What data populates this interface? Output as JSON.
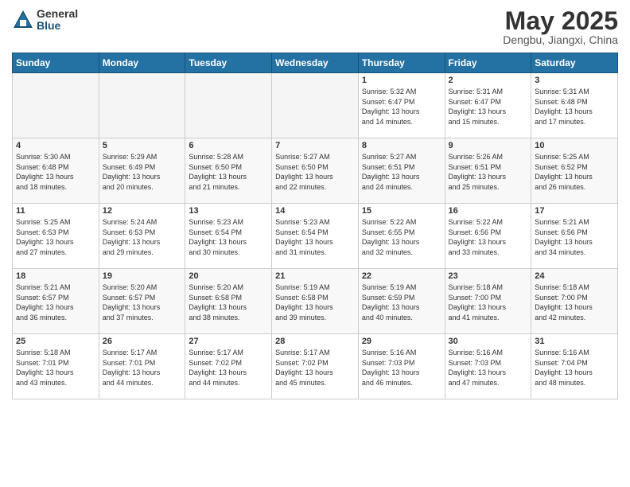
{
  "header": {
    "logo_general": "General",
    "logo_blue": "Blue",
    "month_year": "May 2025",
    "location": "Dengbu, Jiangxi, China"
  },
  "weekdays": [
    "Sunday",
    "Monday",
    "Tuesday",
    "Wednesday",
    "Thursday",
    "Friday",
    "Saturday"
  ],
  "weeks": [
    [
      {
        "day": "",
        "info": ""
      },
      {
        "day": "",
        "info": ""
      },
      {
        "day": "",
        "info": ""
      },
      {
        "day": "",
        "info": ""
      },
      {
        "day": "1",
        "info": "Sunrise: 5:32 AM\nSunset: 6:47 PM\nDaylight: 13 hours\nand 14 minutes."
      },
      {
        "day": "2",
        "info": "Sunrise: 5:31 AM\nSunset: 6:47 PM\nDaylight: 13 hours\nand 15 minutes."
      },
      {
        "day": "3",
        "info": "Sunrise: 5:31 AM\nSunset: 6:48 PM\nDaylight: 13 hours\nand 17 minutes."
      }
    ],
    [
      {
        "day": "4",
        "info": "Sunrise: 5:30 AM\nSunset: 6:48 PM\nDaylight: 13 hours\nand 18 minutes."
      },
      {
        "day": "5",
        "info": "Sunrise: 5:29 AM\nSunset: 6:49 PM\nDaylight: 13 hours\nand 20 minutes."
      },
      {
        "day": "6",
        "info": "Sunrise: 5:28 AM\nSunset: 6:50 PM\nDaylight: 13 hours\nand 21 minutes."
      },
      {
        "day": "7",
        "info": "Sunrise: 5:27 AM\nSunset: 6:50 PM\nDaylight: 13 hours\nand 22 minutes."
      },
      {
        "day": "8",
        "info": "Sunrise: 5:27 AM\nSunset: 6:51 PM\nDaylight: 13 hours\nand 24 minutes."
      },
      {
        "day": "9",
        "info": "Sunrise: 5:26 AM\nSunset: 6:51 PM\nDaylight: 13 hours\nand 25 minutes."
      },
      {
        "day": "10",
        "info": "Sunrise: 5:25 AM\nSunset: 6:52 PM\nDaylight: 13 hours\nand 26 minutes."
      }
    ],
    [
      {
        "day": "11",
        "info": "Sunrise: 5:25 AM\nSunset: 6:53 PM\nDaylight: 13 hours\nand 27 minutes."
      },
      {
        "day": "12",
        "info": "Sunrise: 5:24 AM\nSunset: 6:53 PM\nDaylight: 13 hours\nand 29 minutes."
      },
      {
        "day": "13",
        "info": "Sunrise: 5:23 AM\nSunset: 6:54 PM\nDaylight: 13 hours\nand 30 minutes."
      },
      {
        "day": "14",
        "info": "Sunrise: 5:23 AM\nSunset: 6:54 PM\nDaylight: 13 hours\nand 31 minutes."
      },
      {
        "day": "15",
        "info": "Sunrise: 5:22 AM\nSunset: 6:55 PM\nDaylight: 13 hours\nand 32 minutes."
      },
      {
        "day": "16",
        "info": "Sunrise: 5:22 AM\nSunset: 6:56 PM\nDaylight: 13 hours\nand 33 minutes."
      },
      {
        "day": "17",
        "info": "Sunrise: 5:21 AM\nSunset: 6:56 PM\nDaylight: 13 hours\nand 34 minutes."
      }
    ],
    [
      {
        "day": "18",
        "info": "Sunrise: 5:21 AM\nSunset: 6:57 PM\nDaylight: 13 hours\nand 36 minutes."
      },
      {
        "day": "19",
        "info": "Sunrise: 5:20 AM\nSunset: 6:57 PM\nDaylight: 13 hours\nand 37 minutes."
      },
      {
        "day": "20",
        "info": "Sunrise: 5:20 AM\nSunset: 6:58 PM\nDaylight: 13 hours\nand 38 minutes."
      },
      {
        "day": "21",
        "info": "Sunrise: 5:19 AM\nSunset: 6:58 PM\nDaylight: 13 hours\nand 39 minutes."
      },
      {
        "day": "22",
        "info": "Sunrise: 5:19 AM\nSunset: 6:59 PM\nDaylight: 13 hours\nand 40 minutes."
      },
      {
        "day": "23",
        "info": "Sunrise: 5:18 AM\nSunset: 7:00 PM\nDaylight: 13 hours\nand 41 minutes."
      },
      {
        "day": "24",
        "info": "Sunrise: 5:18 AM\nSunset: 7:00 PM\nDaylight: 13 hours\nand 42 minutes."
      }
    ],
    [
      {
        "day": "25",
        "info": "Sunrise: 5:18 AM\nSunset: 7:01 PM\nDaylight: 13 hours\nand 43 minutes."
      },
      {
        "day": "26",
        "info": "Sunrise: 5:17 AM\nSunset: 7:01 PM\nDaylight: 13 hours\nand 44 minutes."
      },
      {
        "day": "27",
        "info": "Sunrise: 5:17 AM\nSunset: 7:02 PM\nDaylight: 13 hours\nand 44 minutes."
      },
      {
        "day": "28",
        "info": "Sunrise: 5:17 AM\nSunset: 7:02 PM\nDaylight: 13 hours\nand 45 minutes."
      },
      {
        "day": "29",
        "info": "Sunrise: 5:16 AM\nSunset: 7:03 PM\nDaylight: 13 hours\nand 46 minutes."
      },
      {
        "day": "30",
        "info": "Sunrise: 5:16 AM\nSunset: 7:03 PM\nDaylight: 13 hours\nand 47 minutes."
      },
      {
        "day": "31",
        "info": "Sunrise: 5:16 AM\nSunset: 7:04 PM\nDaylight: 13 hours\nand 48 minutes."
      }
    ]
  ]
}
